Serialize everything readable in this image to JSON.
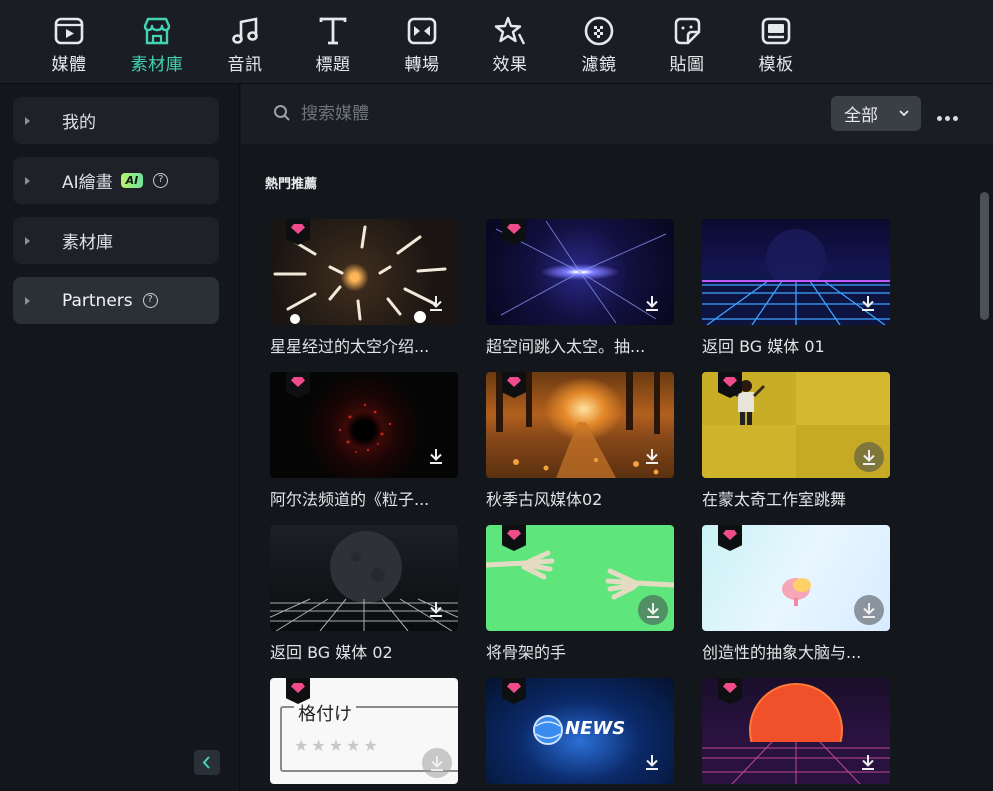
{
  "toolbar": {
    "tabs": [
      {
        "label": "媒體",
        "icon": "media-icon",
        "active": false
      },
      {
        "label": "素材庫",
        "icon": "store-icon",
        "active": true
      },
      {
        "label": "音訊",
        "icon": "music-note-icon",
        "active": false
      },
      {
        "label": "標題",
        "icon": "title-t-icon",
        "active": false
      },
      {
        "label": "轉場",
        "icon": "transition-icon",
        "active": false
      },
      {
        "label": "效果",
        "icon": "effects-star-icon",
        "active": false
      },
      {
        "label": "濾鏡",
        "icon": "filter-icon",
        "active": false
      },
      {
        "label": "貼圖",
        "icon": "sticker-icon",
        "active": false
      },
      {
        "label": "模板",
        "icon": "template-icon",
        "active": false
      }
    ],
    "accent": "#43d3b4"
  },
  "sidebar": {
    "items": [
      {
        "label": "我的"
      },
      {
        "label": "AI繪畫",
        "badge": "AI"
      },
      {
        "label": "素材庫"
      },
      {
        "label": "Partners"
      }
    ]
  },
  "search": {
    "placeholder": "搜索媒體",
    "value": ""
  },
  "filter": {
    "selected": "全部"
  },
  "section": {
    "title": "熱門推薦"
  },
  "cards": [
    {
      "caption": "星星经过的太空介绍..."
    },
    {
      "caption": "超空间跳入太空。抽..."
    },
    {
      "caption": "返回 BG 媒体 01"
    },
    {
      "caption": "阿尔法频道的《粒子..."
    },
    {
      "caption": "秋季古风媒体02"
    },
    {
      "caption": "在蒙太奇工作室跳舞"
    },
    {
      "caption": "返回 BG 媒体 02"
    },
    {
      "caption": "将骨架的手"
    },
    {
      "caption": "创造性的抽象大脑与..."
    },
    {
      "caption": ""
    },
    {
      "caption": ""
    },
    {
      "caption": ""
    }
  ],
  "thumb_text": {
    "rating_label": "格付け",
    "rating_stars": "★★★★★",
    "news_label": "NEWS"
  }
}
